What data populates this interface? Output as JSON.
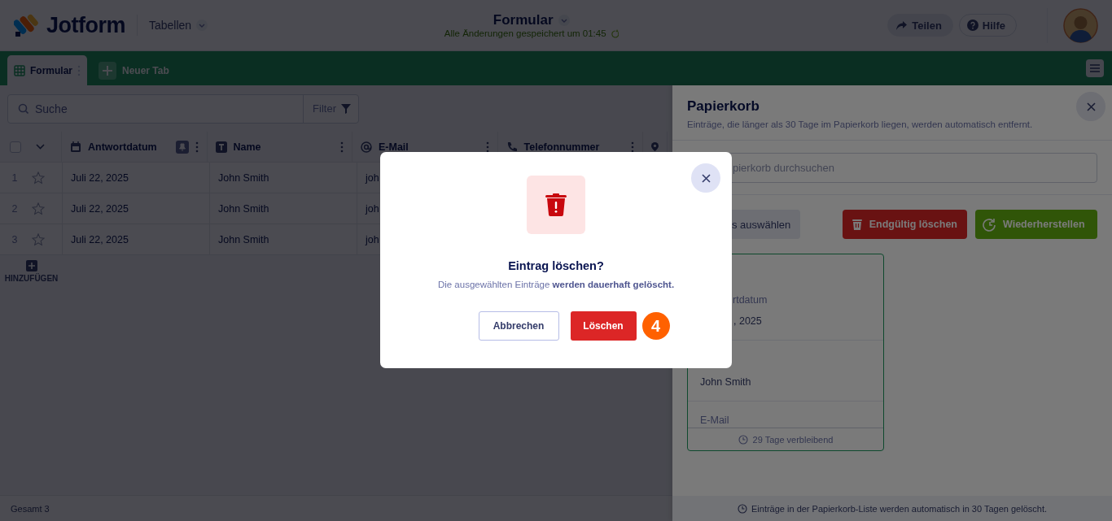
{
  "header": {
    "logo": "Jotform",
    "app_switcher": "Tabellen",
    "title": "Formular",
    "save_status": "Alle Änderungen gespeichert um 01:45",
    "actions": [
      {
        "label": "Teilen",
        "kind": "share"
      },
      {
        "label": "Hilfe",
        "kind": "help"
      }
    ]
  },
  "tabs": [
    {
      "label": "Formular",
      "selected": true
    }
  ],
  "new_tab": "Neuer Tab",
  "toolbar": {
    "search_placeholder": "Suche",
    "filter": "Filter"
  },
  "table": {
    "columns": [
      {
        "label": "Antwortdatum",
        "kind": "date",
        "pinned": true
      },
      {
        "label": "Name",
        "kind": "text",
        "pinned": false
      },
      {
        "label": "E-Mail",
        "kind": "email",
        "pinned": false
      },
      {
        "label": "Telefonnummer",
        "kind": "phone",
        "pinned": false
      }
    ],
    "rows": [
      {
        "number": "1",
        "starred": false,
        "cells": [
          "Juli 22, 2025",
          "John Smith",
          "joh"
        ]
      },
      {
        "number": "2",
        "starred": false,
        "cells": [
          "Juli 22, 2025",
          "John Smith",
          "joh"
        ]
      },
      {
        "number": "3",
        "starred": false,
        "cells": [
          "Juli 22, 2025",
          "John Smith",
          "joh"
        ]
      }
    ],
    "add_column": "HINZUFÜGEN",
    "select_all_checked": false
  },
  "status_bar": "Gesamt 3",
  "trash_panel": {
    "title": "Papierkorb",
    "subtitle": "Einträge, die länger als 30 Tage im Papierkorb liegen, werden automatisch entfernt.",
    "search_placeholder": "pierkorb durchsuchen",
    "select_button": "s auswählen",
    "delete_button": "Endgültig löschen",
    "restore_button": "Wiederherstellen",
    "card": {
      "fields": [
        {
          "label": "rtdatum",
          "value": ", 2025"
        },
        {
          "value": "John Smith"
        },
        {
          "label": "E-Mail"
        }
      ],
      "remaining": "29 Tage verbleibend"
    },
    "footer": "Einträge in der Papierkorb-Liste werden automatisch in 30 Tagen gelöscht."
  },
  "dialog": {
    "title": "Eintrag löschen?",
    "message": "Die ausgewählten Einträge **werden dauerhaft gelöscht.**",
    "cancel": "Abbrechen",
    "confirm": "Löschen",
    "step_badge": "4"
  }
}
